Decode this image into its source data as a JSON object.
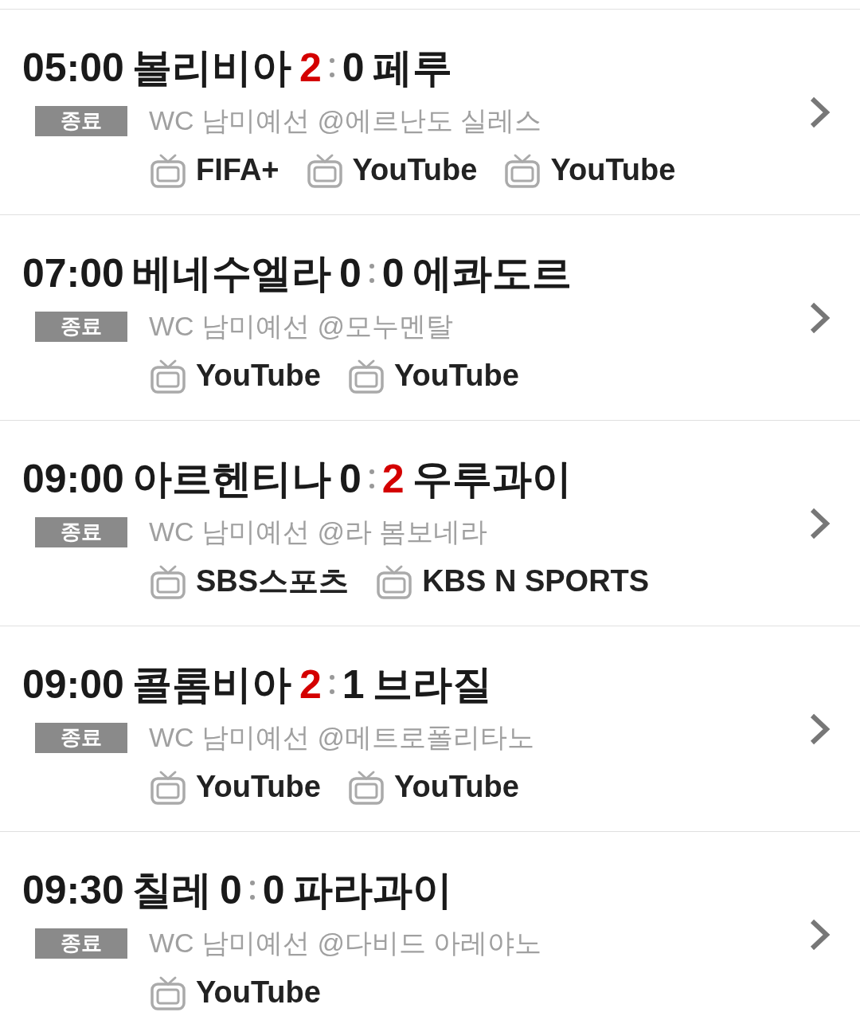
{
  "matches": [
    {
      "time": "05:00",
      "home": "볼리비아",
      "home_score": "2",
      "home_highlight": true,
      "away_score": "0",
      "away_highlight": false,
      "away": "페루",
      "status": "종료",
      "venue": "WC 남미예선 @에르난도 실레스",
      "channels": [
        "FIFA+",
        "YouTube",
        "YouTube"
      ]
    },
    {
      "time": "07:00",
      "home": "베네수엘라",
      "home_score": "0",
      "home_highlight": false,
      "away_score": "0",
      "away_highlight": false,
      "away": "에콰도르",
      "status": "종료",
      "venue": "WC 남미예선 @모누멘탈",
      "channels": [
        "YouTube",
        "YouTube"
      ]
    },
    {
      "time": "09:00",
      "home": "아르헨티나",
      "home_score": "0",
      "home_highlight": false,
      "away_score": "2",
      "away_highlight": true,
      "away": "우루과이",
      "status": "종료",
      "venue": "WC 남미예선 @라 봄보네라",
      "channels": [
        "SBS스포츠",
        "KBS N SPORTS"
      ]
    },
    {
      "time": "09:00",
      "home": "콜롬비아",
      "home_score": "2",
      "home_highlight": true,
      "away_score": "1",
      "away_highlight": false,
      "away": "브라질",
      "status": "종료",
      "venue": "WC 남미예선 @메트로폴리타노",
      "channels": [
        "YouTube",
        "YouTube"
      ]
    },
    {
      "time": "09:30",
      "home": "칠레",
      "home_score": "0",
      "home_highlight": false,
      "away_score": "0",
      "away_highlight": false,
      "away": "파라과이",
      "status": "종료",
      "venue": "WC 남미예선 @다비드 아레야노",
      "channels": [
        "YouTube"
      ]
    }
  ]
}
